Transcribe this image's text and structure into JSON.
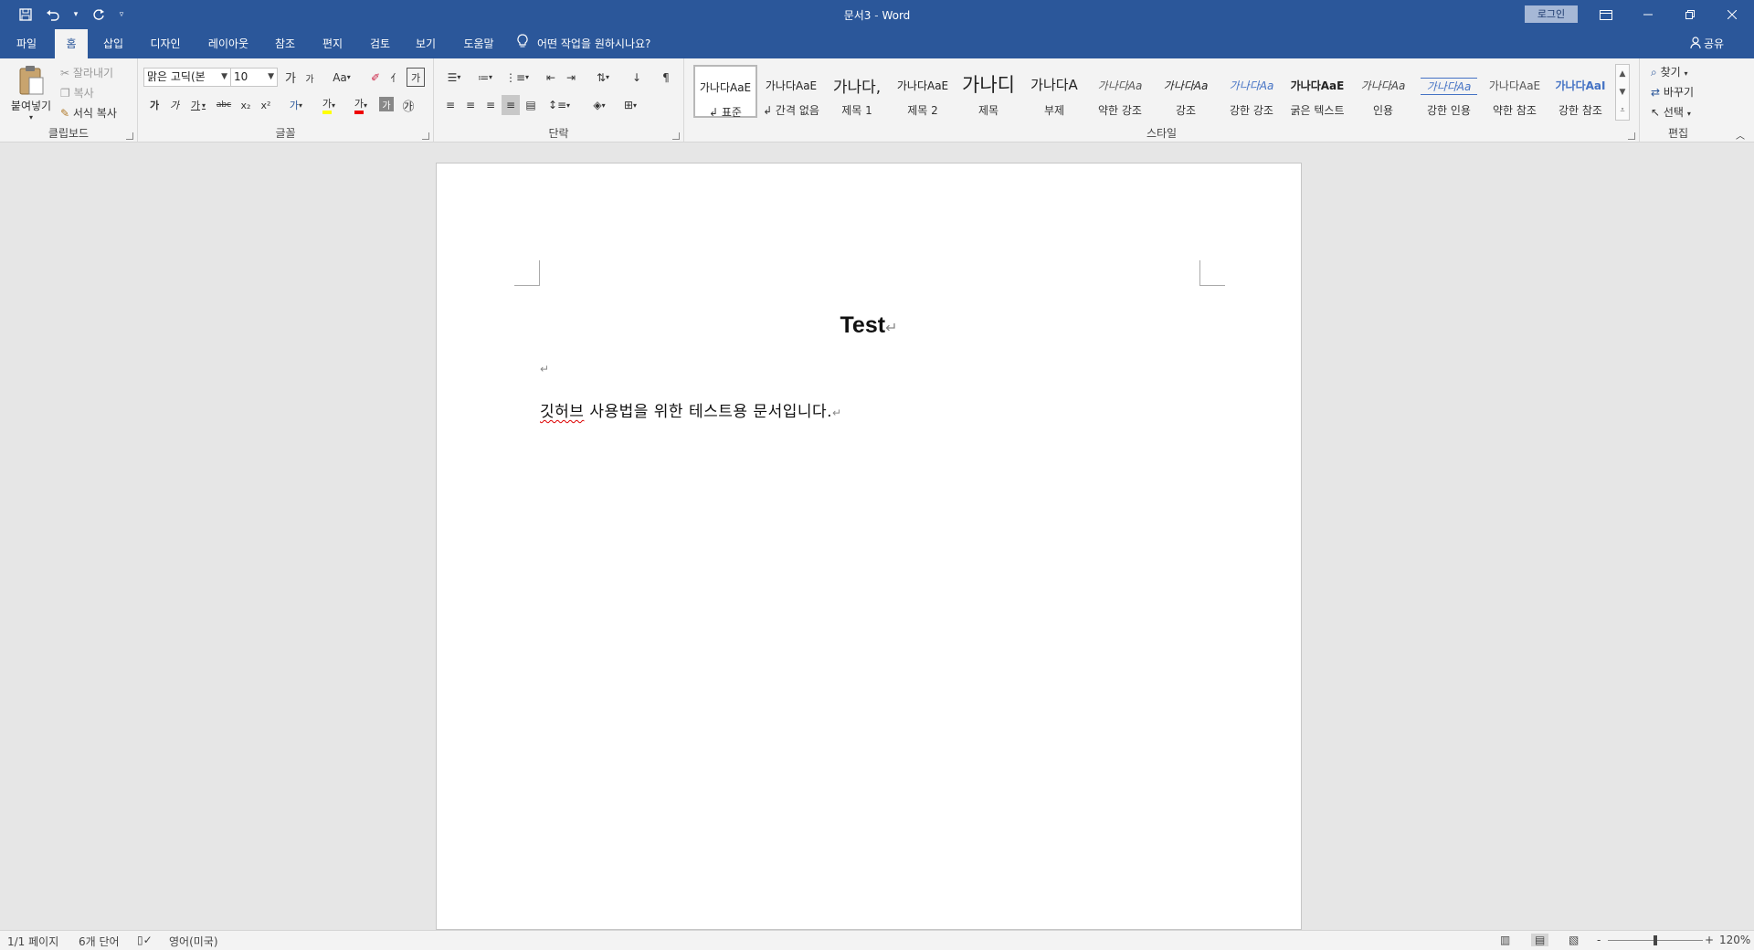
{
  "window": {
    "title_doc": "문서3",
    "title_sep": "-",
    "title_app": "Word",
    "login": "로그인"
  },
  "tabs": [
    {
      "label": "파일"
    },
    {
      "label": "홈"
    },
    {
      "label": "삽입"
    },
    {
      "label": "디자인"
    },
    {
      "label": "레이아웃"
    },
    {
      "label": "참조"
    },
    {
      "label": "편지"
    },
    {
      "label": "검토"
    },
    {
      "label": "보기"
    },
    {
      "label": "도움말"
    }
  ],
  "tellme": "어떤 작업을 원하시나요?",
  "share": "공유",
  "clipboard": {
    "paste": "붙여넣기",
    "cut": "잘라내기",
    "copy": "복사",
    "format_painter": "서식 복사",
    "label": "클립보드"
  },
  "font": {
    "family": "맑은 고딕(본",
    "size": "10",
    "label": "글꼴",
    "grow": "가",
    "shrink": "가",
    "case": "Aa",
    "bold": "가",
    "italic": "가",
    "underline": "가",
    "strike": "abc",
    "subscript": "x₂",
    "superscript": "x²",
    "text_effects": "가",
    "highlight": "가",
    "font_color": "가"
  },
  "paragraph": {
    "label": "단락"
  },
  "styles": {
    "label": "스타일",
    "items": [
      {
        "sample": "가나다AaE",
        "name": "↲ 표준"
      },
      {
        "sample": "가나다AaE",
        "name": "↲ 간격 없음"
      },
      {
        "sample": "가나다,",
        "name": "제목 1"
      },
      {
        "sample": "가나다AaE",
        "name": "제목 2"
      },
      {
        "sample": "가나디",
        "name": "제목"
      },
      {
        "sample": "가나다A",
        "name": "부제"
      },
      {
        "sample": "가나다Aa",
        "name": "약한 강조"
      },
      {
        "sample": "가나다Aa",
        "name": "강조"
      },
      {
        "sample": "가나다Aa",
        "name": "강한 강조"
      },
      {
        "sample": "가나다AaE",
        "name": "굵은 텍스트"
      },
      {
        "sample": "가나다Aa",
        "name": "인용"
      },
      {
        "sample": "가나다Aa",
        "name": "강한 인용"
      },
      {
        "sample": "가나다AaE",
        "name": "약한 참조"
      },
      {
        "sample": "가나다AaI",
        "name": "강한 참조"
      }
    ]
  },
  "editing": {
    "find": "찾기",
    "replace": "바꾸기",
    "select": "선택",
    "label": "편집"
  },
  "document": {
    "title": "Test",
    "body_misspelled": "깃허브",
    "body_rest": " 사용법을 위한 테스트용 문서입니다.",
    "pilcrow": "↵"
  },
  "status": {
    "page": "1/1 페이지",
    "words": "6개 단어",
    "language": "영어(미국)",
    "zoom": "120%",
    "zoom_minus": "-",
    "zoom_plus": "+"
  },
  "colors": {
    "titlebar": "#2b579a",
    "ribbon": "#f3f3f3",
    "background": "#e6e6e6"
  }
}
